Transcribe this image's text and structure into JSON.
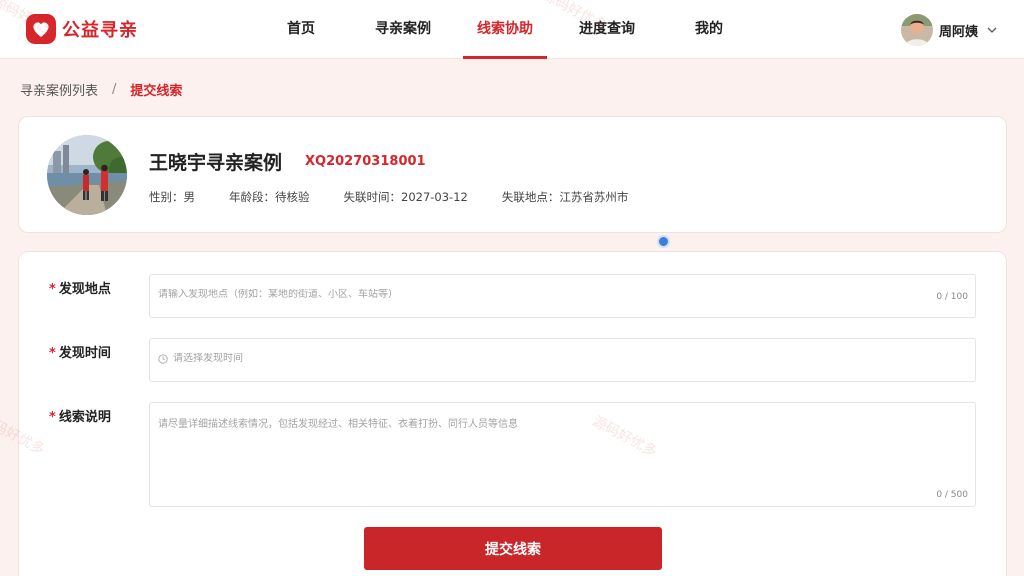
{
  "brand": {
    "name": "公益寻亲",
    "color": "#d6262b"
  },
  "nav": [
    {
      "label": "首页",
      "active": false
    },
    {
      "label": "寻亲案例",
      "active": false
    },
    {
      "label": "线索协助",
      "active": true
    },
    {
      "label": "进度查询",
      "active": false
    },
    {
      "label": "我的",
      "active": false
    }
  ],
  "user": {
    "name": "周阿姨",
    "icon": "chevron-down-icon"
  },
  "breadcrumb": {
    "parent": "寻亲案例列表",
    "separator": "/",
    "current": "提交线索"
  },
  "case": {
    "title": "王晓宇寻亲案例",
    "id": "XQ20270318001",
    "gender": "性别：男",
    "age_group": "年龄段：待核验",
    "lost_time": "失联时间：2027-03-12",
    "lost_place": "失联地点：江苏省苏州市"
  },
  "form": {
    "location": {
      "label": "发现地点",
      "required_mark": "*",
      "placeholder": "请输入发现地点（例如：某地的街道、小区、车站等）",
      "value": "",
      "counter": "0 / 100"
    },
    "time": {
      "label": "发现时间",
      "required_mark": "*",
      "placeholder": "请选择发现时间",
      "value": "",
      "icon": "clock-icon"
    },
    "description": {
      "label": "线索说明",
      "required_mark": "*",
      "placeholder": "请尽量详细描述线索情况，包括发现经过、相关特征、衣着打扮、同行人员等信息",
      "value": "",
      "counter": "0 / 500"
    },
    "submit_label": "提交线索"
  },
  "watermark": "源码好优多"
}
